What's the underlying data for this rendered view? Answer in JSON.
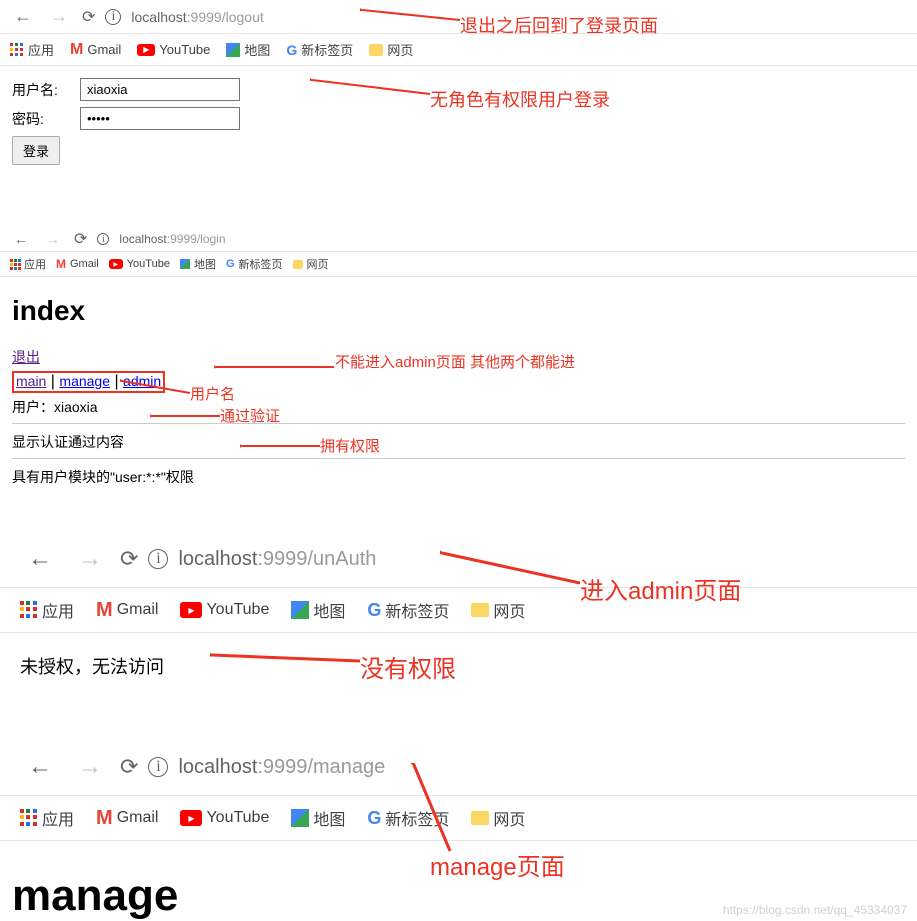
{
  "section1": {
    "url_host": "localhost",
    "url_port": ":9999",
    "url_path": "/logout",
    "bookmarks": {
      "apps": "应用",
      "gmail": "Gmail",
      "youtube": "YouTube",
      "maps": "地图",
      "newtab": "新标签页",
      "web": "网页"
    },
    "form": {
      "user_label": "用户名:",
      "user_value": "xiaoxia",
      "pass_label": "密码:",
      "pass_value": "•••••",
      "login_btn": "登录"
    },
    "annot1": "退出之后回到了登录页面",
    "annot2": "无角色有权限用户登录"
  },
  "section2": {
    "url_host": "localhost",
    "url_port": ":9999",
    "url_path": "/login",
    "bookmarks": {
      "apps": "应用",
      "gmail": "Gmail",
      "youtube": "YouTube",
      "maps": "地图",
      "newtab": "新标签页",
      "web": "网页"
    },
    "heading": "index",
    "logout": "退出",
    "nav_main": "main",
    "nav_sep": " | ",
    "nav_manage": "manage",
    "nav_admin": "admin",
    "user_line": "用户：xiaoxia",
    "auth_line": "显示认证通过内容",
    "perm_line": "具有用户模块的\"user:*:*\"权限",
    "annot_admin": "不能进入admin页面 其他两个都能进",
    "annot_user": "用户名",
    "annot_auth": "通过验证",
    "annot_perm": "拥有权限"
  },
  "section3": {
    "url_host": "localhost",
    "url_port": ":9999",
    "url_path": "/unAuth",
    "bookmarks": {
      "apps": "应用",
      "gmail": "Gmail",
      "youtube": "YouTube",
      "maps": "地图",
      "newtab": "新标签页",
      "web": "网页"
    },
    "unauth_text": "未授权，无法访问",
    "annot_enter": "进入admin页面",
    "annot_noperm": "没有权限"
  },
  "section4": {
    "url_host": "localhost",
    "url_port": ":9999",
    "url_path": "/manage",
    "bookmarks": {
      "apps": "应用",
      "gmail": "Gmail",
      "youtube": "YouTube",
      "maps": "地图",
      "newtab": "新标签页",
      "web": "网页"
    },
    "annot": "manage页面",
    "heading": "manage"
  },
  "watermark": "https://blog.csdn.net/qq_45334037"
}
